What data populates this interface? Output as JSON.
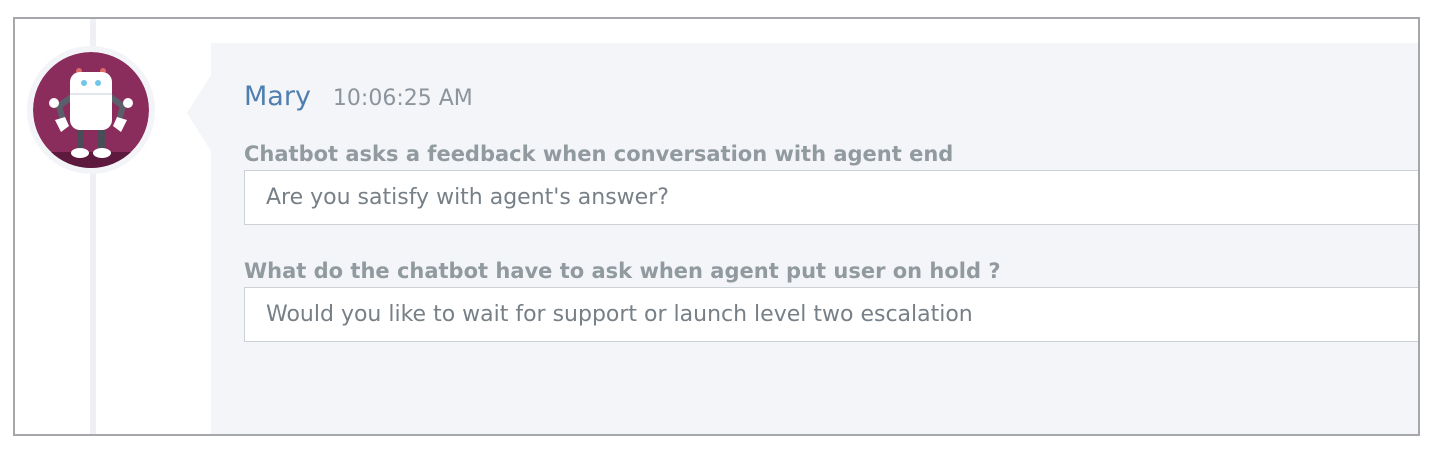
{
  "message": {
    "sender": "Mary",
    "time": "10:06:25 AM",
    "avatar": {
      "icon": "robot-icon",
      "background_color": "#8a2d5c"
    }
  },
  "fields": [
    {
      "label": "Chatbot asks a feedback when conversation with agent end",
      "value": "Are you satisfy with agent's answer?"
    },
    {
      "label": "What do the chatbot have to ask when agent put user on hold ?",
      "value": "Would you like to wait for support or launch level two escalation"
    }
  ],
  "colors": {
    "sender_name": "#4f7fae",
    "label_text": "#909a9f",
    "bubble_background": "#f4f5f9",
    "frame_border": "#a5a7aa"
  }
}
